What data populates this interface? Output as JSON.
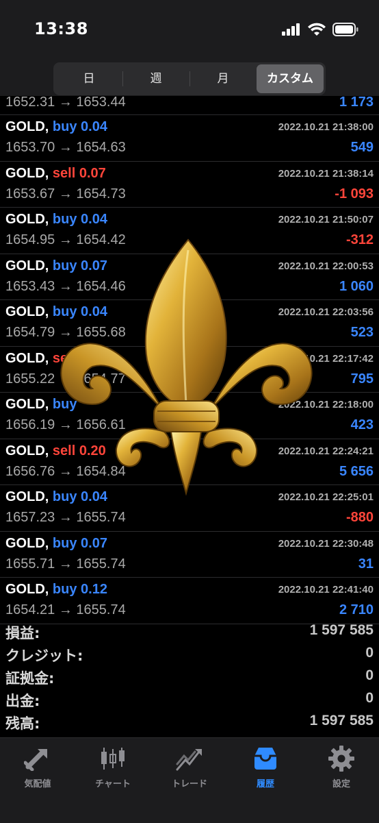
{
  "status": {
    "time": "13:38"
  },
  "segments": [
    {
      "label": "日",
      "active": false
    },
    {
      "label": "週",
      "active": false
    },
    {
      "label": "月",
      "active": false
    },
    {
      "label": "カスタム",
      "active": true
    }
  ],
  "partial_row": {
    "prices": "1652.31 → 1653.44",
    "profit": "1 173",
    "profit_sign": "pos"
  },
  "deals": [
    {
      "symbol": "GOLD,",
      "type": "buy 0.04",
      "side": "buy",
      "time": "2022.10.21 21:38:00",
      "prices": "1653.70 → 1654.63",
      "profit": "549",
      "profit_sign": "pos"
    },
    {
      "symbol": "GOLD,",
      "type": "sell 0.07",
      "side": "sell",
      "time": "2022.10.21 21:38:14",
      "prices": "1653.67 → 1654.73",
      "profit": "-1 093",
      "profit_sign": "neg"
    },
    {
      "symbol": "GOLD,",
      "type": "buy 0.04",
      "side": "buy",
      "time": "2022.10.21 21:50:07",
      "prices": "1654.95 → 1654.42",
      "profit": "-312",
      "profit_sign": "neg"
    },
    {
      "symbol": "GOLD,",
      "type": "buy 0.07",
      "side": "buy",
      "time": "2022.10.21 22:00:53",
      "prices": "1653.43 → 1654.46",
      "profit": "1 060",
      "profit_sign": "pos"
    },
    {
      "symbol": "GOLD,",
      "type": "buy 0.04",
      "side": "buy",
      "time": "2022.10.21 22:03:56",
      "prices": "1654.79 → 1655.68",
      "profit": "523",
      "profit_sign": "pos"
    },
    {
      "symbol": "GOLD,",
      "type": "sell",
      "side": "sell",
      "time": "2022.10.21 22:17:42",
      "prices": "1655.22 → 1654.77",
      "profit": "795",
      "profit_sign": "pos"
    },
    {
      "symbol": "GOLD,",
      "type": "buy",
      "side": "buy",
      "time": "2022.10.21 22:18:00",
      "prices": "1656.19 → 1656.61",
      "profit": "423",
      "profit_sign": "pos"
    },
    {
      "symbol": "GOLD,",
      "type": "sell 0.20",
      "side": "sell",
      "time": "2022.10.21 22:24:21",
      "prices": "1656.76 → 1654.84",
      "profit": "5 656",
      "profit_sign": "pos"
    },
    {
      "symbol": "GOLD,",
      "type": "buy 0.04",
      "side": "buy",
      "time": "2022.10.21 22:25:01",
      "prices": "1657.23 → 1655.74",
      "profit": "-880",
      "profit_sign": "neg"
    },
    {
      "symbol": "GOLD,",
      "type": "buy 0.07",
      "side": "buy",
      "time": "2022.10.21 22:30:48",
      "prices": "1655.71 → 1655.74",
      "profit": "31",
      "profit_sign": "pos"
    },
    {
      "symbol": "GOLD,",
      "type": "buy 0.12",
      "side": "buy",
      "time": "2022.10.21 22:41:40",
      "prices": "1654.21 → 1655.74",
      "profit": "2 710",
      "profit_sign": "pos"
    }
  ],
  "summary": [
    {
      "label": "損益:",
      "value": "1 597 585"
    },
    {
      "label": "クレジット:",
      "value": "0"
    },
    {
      "label": "証拠金:",
      "value": "0"
    },
    {
      "label": "出金:",
      "value": "0"
    },
    {
      "label": "残高:",
      "value": "1 597 585"
    }
  ],
  "tabs": [
    {
      "label": "気配値",
      "icon": "quotes-arrows-icon",
      "active": false
    },
    {
      "label": "チャート",
      "icon": "candlestick-chart-icon",
      "active": false
    },
    {
      "label": "トレード",
      "icon": "trade-line-icon",
      "active": false
    },
    {
      "label": "履歴",
      "icon": "history-tray-icon",
      "active": true
    },
    {
      "label": "設定",
      "icon": "gear-icon",
      "active": false
    }
  ],
  "colors": {
    "buy": "#3a86ff",
    "sell": "#ff453a",
    "active_tab": "#2f8bff",
    "background": "#000000",
    "emblem": "gold fleur-de-lis"
  },
  "overlay": {
    "icon": "fleur-de-lis-icon"
  }
}
